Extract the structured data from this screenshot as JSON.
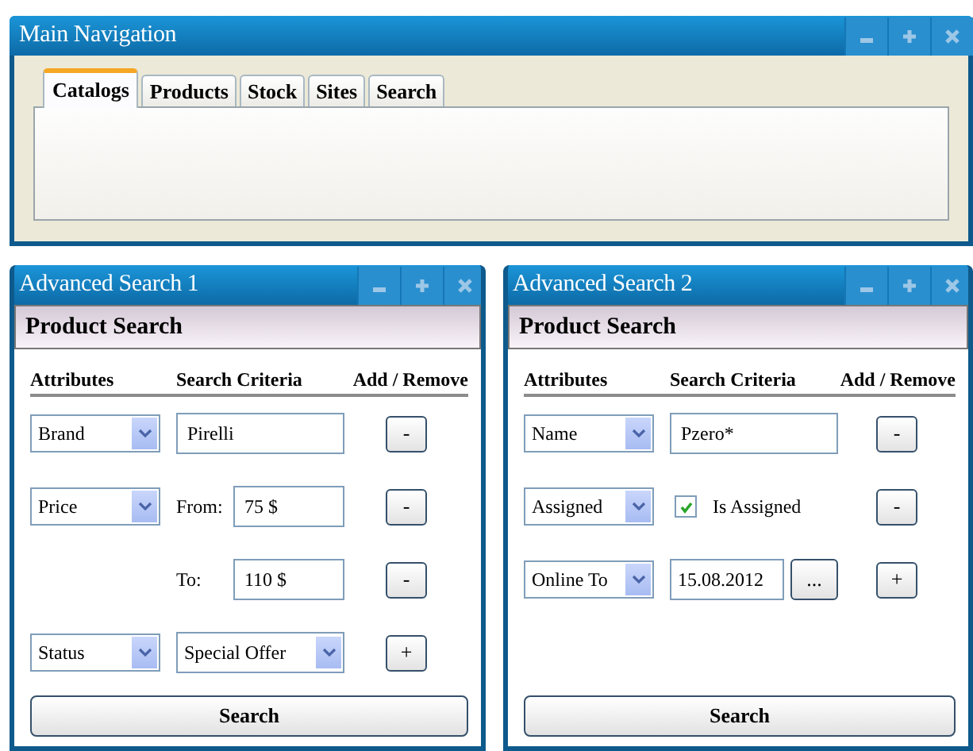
{
  "main_window": {
    "title": "Main Navigation",
    "tabs": [
      {
        "label": "Catalogs",
        "selected": true
      },
      {
        "label": "Products",
        "selected": false
      },
      {
        "label": "Stock",
        "selected": false
      },
      {
        "label": "Sites",
        "selected": false
      },
      {
        "label": "Search",
        "selected": false
      }
    ]
  },
  "search_windows": [
    {
      "title": "Advanced Search 1",
      "header": "Product Search",
      "columns": [
        "Attributes",
        "Search Criteria",
        "Add / Remove"
      ],
      "rows": [
        {
          "kind": "input",
          "attribute": "Brand",
          "value": "Pirelli",
          "action": "-"
        },
        {
          "kind": "input",
          "attribute": "Price",
          "label": "From:",
          "value": "75 $",
          "action": "-"
        },
        {
          "kind": "input",
          "label": "To:",
          "value": "110 $",
          "action": "-"
        },
        {
          "kind": "select",
          "attribute": "Status",
          "value": "Special Offer",
          "action": "+"
        }
      ],
      "button": "Search"
    },
    {
      "title": "Advanced Search 2",
      "header": "Product Search",
      "columns": [
        "Attributes",
        "Search Criteria",
        "Add / Remove"
      ],
      "rows": [
        {
          "kind": "input",
          "attribute": "Name",
          "value": "Pzero*",
          "action": "-"
        },
        {
          "kind": "checkbox",
          "attribute": "Assigned",
          "label": "Is Assigned",
          "checked": true,
          "action": "-"
        },
        {
          "kind": "date",
          "attribute": "Online To",
          "value": "15.08.2012",
          "picker": "...",
          "action": "+"
        }
      ],
      "button": "Search"
    }
  ]
}
